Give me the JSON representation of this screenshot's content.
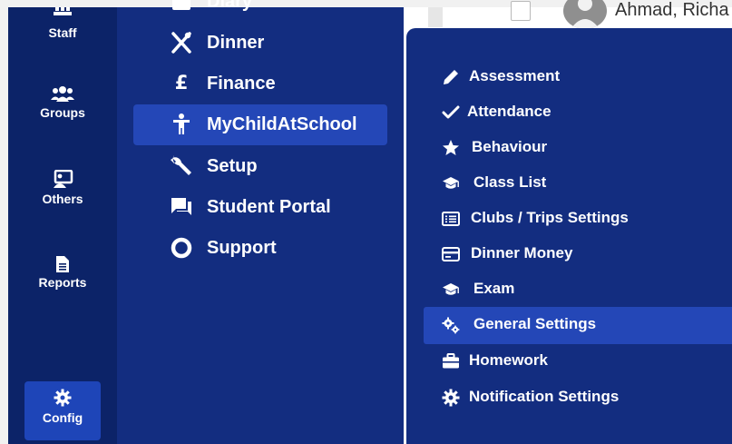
{
  "rail": {
    "items": [
      {
        "label": "Staff",
        "icon": "staff-icon"
      },
      {
        "label": "Groups",
        "icon": "groups-icon"
      },
      {
        "label": "Others",
        "icon": "others-icon"
      },
      {
        "label": "Reports",
        "icon": "reports-icon"
      }
    ],
    "config": {
      "label": "Config",
      "icon": "gear-icon"
    }
  },
  "menu2": {
    "items": [
      {
        "label": "Diary",
        "icon": "diary-icon"
      },
      {
        "label": "Dinner",
        "icon": "cutlery-icon"
      },
      {
        "label": "Finance",
        "icon": "pound-icon"
      },
      {
        "label": "MyChildAtSchool",
        "icon": "child-icon",
        "active": true
      },
      {
        "label": "Setup",
        "icon": "wrench-icon"
      },
      {
        "label": "Student Portal",
        "icon": "chat-icon"
      },
      {
        "label": "Support",
        "icon": "ring-icon"
      }
    ]
  },
  "menu3": {
    "items": [
      {
        "label": "Assessment",
        "icon": "pencil-icon"
      },
      {
        "label": "Attendance",
        "icon": "check-icon"
      },
      {
        "label": "Behaviour",
        "icon": "star-icon"
      },
      {
        "label": "Class List",
        "icon": "graduation-cap-icon"
      },
      {
        "label": "Clubs / Trips Settings",
        "icon": "list-icon"
      },
      {
        "label": "Dinner Money",
        "icon": "card-icon"
      },
      {
        "label": "Exam",
        "icon": "graduation-cap-icon"
      },
      {
        "label": "General Settings",
        "icon": "cogs-icon",
        "active": true
      },
      {
        "label": "Homework",
        "icon": "briefcase-icon"
      },
      {
        "label": "Notification Settings",
        "icon": "gear-icon"
      }
    ]
  },
  "background": {
    "row_name": "Ahmad, Richa"
  },
  "colors": {
    "rail": "#0c2368",
    "menu": "#132d80",
    "active": "#2447b7",
    "config_active": "#1e45b8"
  }
}
